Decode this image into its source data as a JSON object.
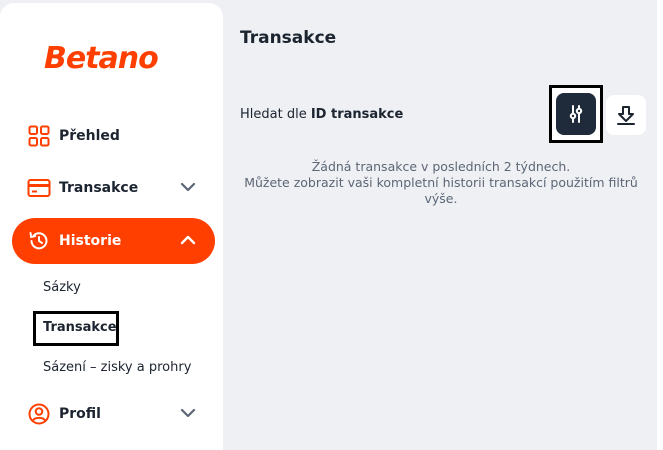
{
  "brand": {
    "logo_text": "Betano",
    "accent": "#ff3f00"
  },
  "sidebar": {
    "items": [
      {
        "label": "Přehled",
        "icon": "grid-icon"
      },
      {
        "label": "Transakce",
        "icon": "card-icon",
        "chevron": "chevron-down-icon"
      },
      {
        "label": "Historie",
        "icon": "history-icon",
        "chevron": "chevron-up-icon",
        "active": true
      },
      {
        "label": "Profil",
        "icon": "user-icon",
        "chevron": "chevron-down-icon"
      }
    ],
    "subitems": [
      {
        "label": "Sázky"
      },
      {
        "label": "Transakce",
        "selected": true
      },
      {
        "label": "Sázení – zisky a prohry"
      }
    ]
  },
  "main": {
    "title": "Transakce",
    "search_label_prefix": "Hledat dle ",
    "search_label_bold": "ID transakce",
    "empty_line1": "Žádná transakce v posledních 2 týdnech.",
    "empty_line2": "Můžete zobrazit vaši kompletní historii transakcí použitím filtrů výše."
  },
  "actions": {
    "filter_icon": "filter-sliders-icon",
    "download_icon": "download-icon"
  }
}
